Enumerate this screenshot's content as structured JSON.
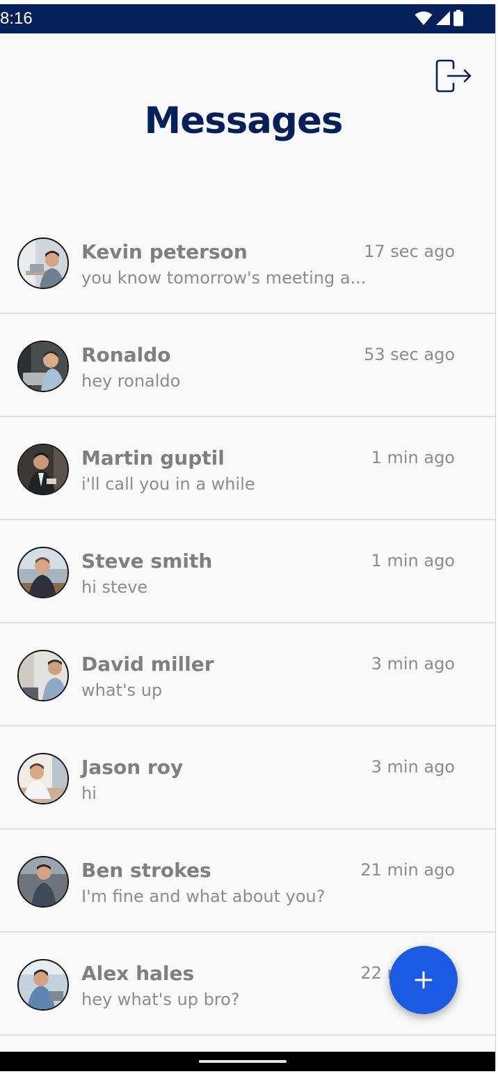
{
  "status_bar": {
    "time": "8:16",
    "icons": [
      "wifi-icon",
      "signal-icon",
      "battery-icon"
    ],
    "background": "#03205a"
  },
  "header": {
    "title": "Messages",
    "logout_icon": "logout-icon",
    "title_color": "#03205a"
  },
  "conversations": [
    {
      "name": "Kevin peterson",
      "preview": "you know tomorrow's meeting a...",
      "time": "17 sec ago"
    },
    {
      "name": "Ronaldo",
      "preview": "hey ronaldo",
      "time": "53 sec ago"
    },
    {
      "name": "Martin guptil",
      "preview": "i'll call you in a while",
      "time": "1 min ago"
    },
    {
      "name": "Steve smith",
      "preview": "hi steve",
      "time": "1 min ago"
    },
    {
      "name": "David miller",
      "preview": "what's up",
      "time": "3 min ago"
    },
    {
      "name": "Jason roy",
      "preview": "hi",
      "time": "3 min ago"
    },
    {
      "name": "Ben strokes",
      "preview": "I'm fine and what about you?",
      "time": "21 min ago"
    },
    {
      "name": "Alex hales",
      "preview": "hey what's up bro?",
      "time": "22 min ago"
    }
  ],
  "fab": {
    "icon": "plus-icon",
    "color": "#1b5be3"
  }
}
